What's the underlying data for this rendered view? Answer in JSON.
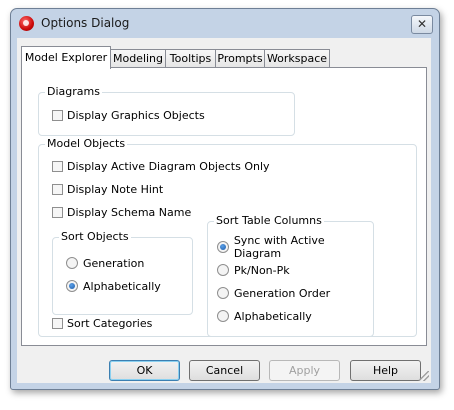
{
  "window": {
    "title": "Options Dialog"
  },
  "tabs": [
    {
      "label": "Model Explorer",
      "active": true
    },
    {
      "label": "Modeling",
      "active": false
    },
    {
      "label": "Tooltips",
      "active": false
    },
    {
      "label": "Prompts",
      "active": false
    },
    {
      "label": "Workspace",
      "active": false
    }
  ],
  "diagrams": {
    "legend": "Diagrams",
    "display_graphics_objects": {
      "label": "Display Graphics Objects",
      "checked": false
    }
  },
  "model_objects": {
    "legend": "Model Objects",
    "checkboxes": [
      {
        "label": "Display Active Diagram Objects Only",
        "checked": false
      },
      {
        "label": "Display Note Hint",
        "checked": false
      },
      {
        "label": "Display Schema Name",
        "checked": false
      }
    ],
    "sort_objects": {
      "legend": "Sort Objects",
      "options": [
        {
          "label": "Generation",
          "selected": false
        },
        {
          "label": "Alphabetically",
          "selected": true
        }
      ]
    },
    "sort_table_columns": {
      "legend": "Sort Table Columns",
      "options": [
        {
          "label": "Sync with Active Diagram",
          "selected": true
        },
        {
          "label": "Pk/Non-Pk",
          "selected": false
        },
        {
          "label": "Generation Order",
          "selected": false
        },
        {
          "label": "Alphabetically",
          "selected": false
        }
      ]
    },
    "sort_categories": {
      "label": "Sort Categories",
      "checked": false
    }
  },
  "buttons": {
    "ok": "OK",
    "cancel": "Cancel",
    "apply": "Apply",
    "help": "Help"
  },
  "colors": {
    "frame": "#c4d3e6",
    "client": "#f0f0f0",
    "radio_selected": "#1d5aa8",
    "default_button_border": "#3c7fb1"
  },
  "icons": {
    "app": "app-logo-icon",
    "close": "close-icon"
  }
}
